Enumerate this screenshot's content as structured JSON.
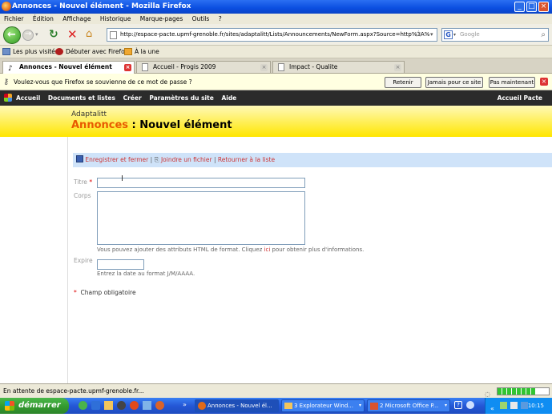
{
  "window": {
    "title": "Annonces - Nouvel élément - Mozilla Firefox",
    "min_icon": "minimize-icon",
    "max_icon": "maximize-icon",
    "close_icon": "close-icon"
  },
  "menu": [
    "Fichier",
    "Édition",
    "Affichage",
    "Historique",
    "Marque-pages",
    "Outils",
    "?"
  ],
  "navbar": {
    "url": "http://espace-pacte.upmf-grenoble.fr/sites/adaptalitt/Lists/Announcements/NewForm.aspx?Source=http%3A%",
    "search_placeholder": "Google"
  },
  "bookmarks": [
    "Les plus visités",
    "Débuter avec Firefox",
    "À la une"
  ],
  "tabs": [
    {
      "label": "Annonces - Nouvel élément",
      "active": true
    },
    {
      "label": "Accueil - Progis 2009",
      "active": false
    },
    {
      "label": "Impact - Qualite",
      "active": false
    }
  ],
  "password_bar": {
    "message": "Voulez-vous que Firefox se souvienne de ce mot de passe ?",
    "buttons": [
      "Retenir",
      "Jamais pour ce site",
      "Pas maintenant"
    ]
  },
  "sharepoint": {
    "nav": [
      "Accueil",
      "Documents et listes",
      "Créer",
      "Paramètres du site",
      "Aide"
    ],
    "right": "Accueil Pacte",
    "site_name": "Adaptalitt",
    "list_name": "Annonces",
    "page_suffix": " : Nouvel élément"
  },
  "form": {
    "toolbar": [
      "Enregistrer et fermer",
      "Joindre un fichier",
      "Retourner à la liste"
    ],
    "title_label": "Titre",
    "required_star": "*",
    "body_label": "Corps",
    "body_help_before": "Vous pouvez ajouter des attributs HTML de format. Cliquez ",
    "body_help_link": "ici",
    "body_help_after": " pour obtenir plus d'informations.",
    "expire_label": "Expire",
    "expire_help": "Entrez la date au format J/M/AAAA.",
    "required_note": "Champ obligatoire"
  },
  "status": {
    "text": "En attente de espace-pacte.upmf-grenoble.fr...",
    "progress": 0.75
  },
  "taskbar": {
    "start": "démarrer",
    "tasks": [
      {
        "label": "Annonces - Nouvel él...",
        "active": true
      },
      {
        "label": "3 Explorateur Wind...",
        "active": false
      },
      {
        "label": "2 Microsoft Office P...",
        "active": false
      }
    ],
    "clock": "10:15"
  },
  "colors": {
    "xp_blue": "#0b4ee0",
    "sp_dark": "#2b2b2b",
    "sp_yellow": "#ffe600",
    "sp_orange": "#e85a00",
    "toolbar_blue": "#cfe3f9",
    "start_green": "#33992f"
  }
}
